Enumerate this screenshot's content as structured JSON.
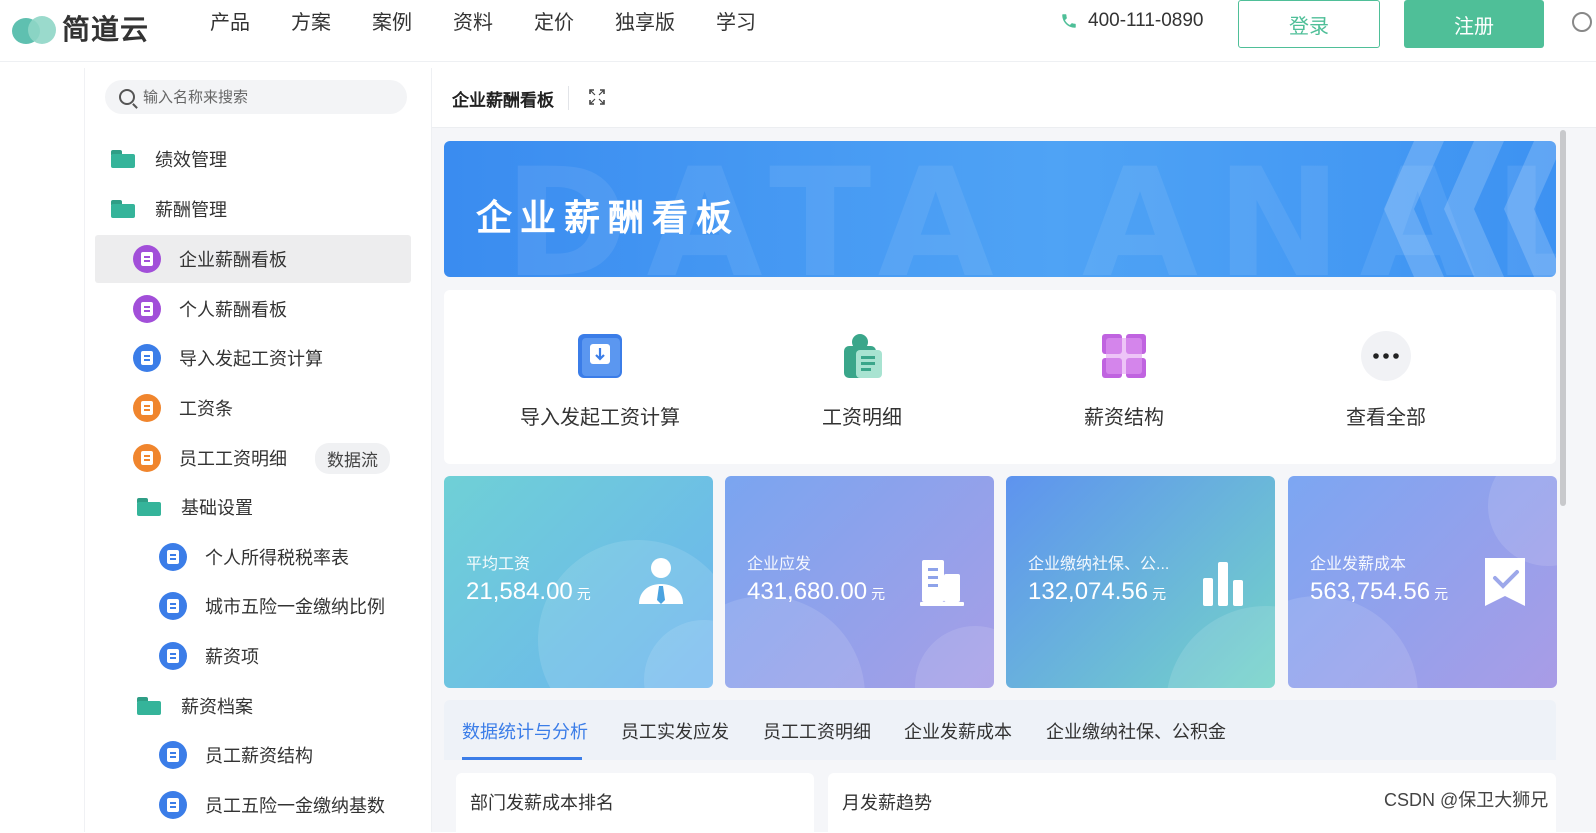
{
  "brand": {
    "name": "简道云"
  },
  "nav": {
    "items": [
      "产品",
      "方案",
      "案例",
      "资料",
      "定价",
      "独享版",
      "学习"
    ]
  },
  "header": {
    "phone": "400-111-0890",
    "login_label": "登录",
    "register_label": "注册"
  },
  "sidebar": {
    "search_placeholder": "输入名称来搜索",
    "items": [
      {
        "label": "绩效管理",
        "icon": "folder-icon"
      },
      {
        "label": "薪酬管理",
        "icon": "folder-icon"
      },
      {
        "label": "企业薪酬看板",
        "icon": "dashboard-icon",
        "active": true
      },
      {
        "label": "个人薪酬看板",
        "icon": "dashboard-icon"
      },
      {
        "label": "导入发起工资计算",
        "icon": "form-icon"
      },
      {
        "label": "工资条",
        "icon": "form-icon"
      },
      {
        "label": "员工工资明细",
        "icon": "form-icon",
        "tag": "数据流"
      },
      {
        "label": "基础设置",
        "icon": "folder-icon"
      },
      {
        "label": "个人所得税税率表",
        "icon": "form-icon"
      },
      {
        "label": "城市五险一金缴纳比例",
        "icon": "form-icon"
      },
      {
        "label": "薪资项",
        "icon": "form-icon"
      },
      {
        "label": "薪资档案",
        "icon": "folder-icon"
      },
      {
        "label": "员工薪资结构",
        "icon": "form-icon"
      },
      {
        "label": "员工五险一金缴纳基数",
        "icon": "form-icon"
      }
    ]
  },
  "main": {
    "tab_title": "企业薪酬看板",
    "banner": {
      "title": "企业薪酬看板",
      "bg_text": "DATA ANALYSIS"
    },
    "shortcuts": [
      {
        "label": "导入发起工资计算",
        "icon": "import-icon"
      },
      {
        "label": "工资明细",
        "icon": "document-icon"
      },
      {
        "label": "薪资结构",
        "icon": "grid-icon"
      },
      {
        "label": "查看全部",
        "icon": "more-icon"
      }
    ],
    "stats": [
      {
        "label": "平均工资",
        "value": "21,584.00",
        "unit": "元",
        "icon": "user-icon"
      },
      {
        "label": "企业应发",
        "value": "431,680.00",
        "unit": "元",
        "icon": "building-icon"
      },
      {
        "label": "企业缴纳社保、公...",
        "value": "132,074.56",
        "unit": "元",
        "icon": "bar-chart-icon"
      },
      {
        "label": "企业发薪成本",
        "value": "563,754.56",
        "unit": "元",
        "icon": "check-badge-icon"
      }
    ],
    "tabs": [
      "数据统计与分析",
      "员工实发应发",
      "员工工资明细",
      "企业发薪成本",
      "企业缴纳社保、公积金"
    ],
    "panels": [
      "部门发薪成本排名",
      "月发薪趋势"
    ]
  },
  "watermark": "CSDN @保卫大狮兄",
  "colors": {
    "accent": "#4fbf98",
    "blue": "#3b7de8",
    "purple": "#a24fd9",
    "orange": "#f0852d"
  }
}
